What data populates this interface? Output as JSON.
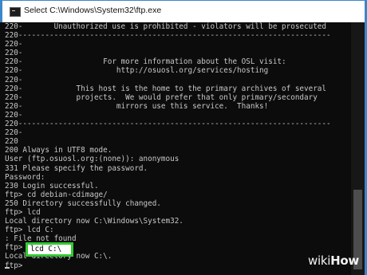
{
  "window": {
    "title": "Select C:\\Windows\\System32\\ftp.exe"
  },
  "console_lines": [
    "220-       Unauthorized use is prohibited - violators will be prosecuted",
    "220----------------------------------------------------------------------",
    "220-",
    "220-",
    "220-                  For more information about the OSL visit:",
    "220-                     http://osuosl.org/services/hosting",
    "220-",
    "220-            This host is the home to the primary archives of several",
    "220-            projects.  We would prefer that only primary/secondary",
    "220-                     mirrors use this service.  Thanks!",
    "220-",
    "220----------------------------------------------------------------------",
    "220-",
    "220",
    "200 Always in UTF8 mode.",
    "User (ftp.osuosl.org:(none)): anonymous",
    "331 Please specify the password.",
    "Password:",
    "230 Login successful.",
    "ftp> cd debian-cdimage/",
    "250 Directory successfully changed.",
    "ftp> lcd",
    "Local directory now C:\\Windows\\System32.",
    "ftp> lcd C:",
    ": File not found",
    "ftp> lcd C:\\",
    "Local directory now C:\\.",
    "ftp>"
  ],
  "highlight": {
    "command": "lcd C:\\",
    "color": "#31c931"
  },
  "watermark": {
    "wiki": "wiki",
    "how": "How"
  }
}
